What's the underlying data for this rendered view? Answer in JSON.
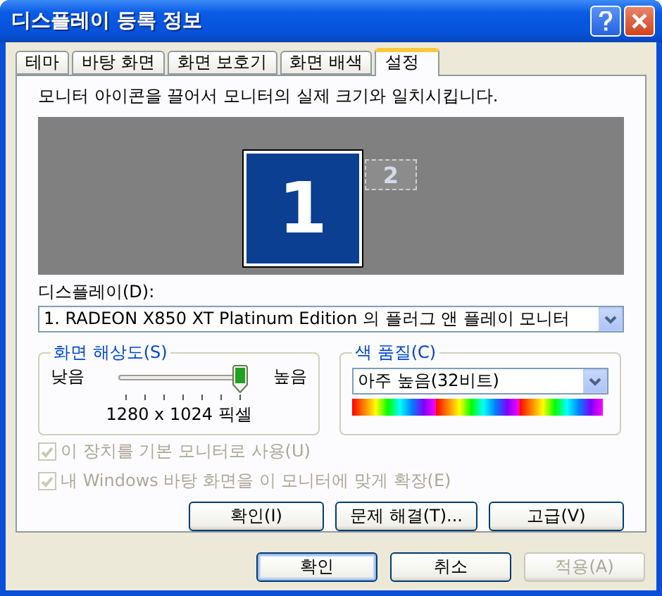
{
  "window": {
    "title": "디스플레이 등록 정보"
  },
  "tabs": [
    {
      "label": "테마",
      "selected": false
    },
    {
      "label": "바탕 화면",
      "selected": false
    },
    {
      "label": "화면 보호기",
      "selected": false
    },
    {
      "label": "화면 배색",
      "selected": false
    },
    {
      "label": "설정",
      "selected": true
    }
  ],
  "instruction": "모니터 아이콘을 끌어서 모니터의 실제 크기와 일치시킵니다.",
  "monitors": [
    {
      "number": "1",
      "selected": true
    },
    {
      "number": "2",
      "selected": false
    }
  ],
  "display": {
    "label": "디스플레이(D):",
    "value": "1. RADEON X850 XT Platinum Edition 의 플러그 앤 플레이 모니터"
  },
  "resolution": {
    "title": "화면 해상도(S)",
    "low": "낮음",
    "high": "높음",
    "level": 1,
    "reading": "1280 x 1024 픽셀"
  },
  "color_quality": {
    "title": "색 품질(C)",
    "value": "아주 높음(32비트)"
  },
  "checkboxes": [
    {
      "label": "이 장치를 기본 모니터로 사용(U)",
      "checked": true,
      "disabled": true
    },
    {
      "label": "내 Windows 바탕 화면을 이 모니터에 맞게 확장(E)",
      "checked": true,
      "disabled": true
    }
  ],
  "panel_buttons": [
    {
      "label": "확인(I)",
      "disabled": false
    },
    {
      "label": "문제 해결(T)...",
      "disabled": false
    },
    {
      "label": "고급(V)",
      "disabled": false
    }
  ],
  "dialog_buttons": [
    {
      "label": "확인",
      "disabled": false,
      "default": true
    },
    {
      "label": "취소",
      "disabled": false,
      "default": false
    },
    {
      "label": "적용(A)",
      "disabled": true,
      "default": false
    }
  ]
}
